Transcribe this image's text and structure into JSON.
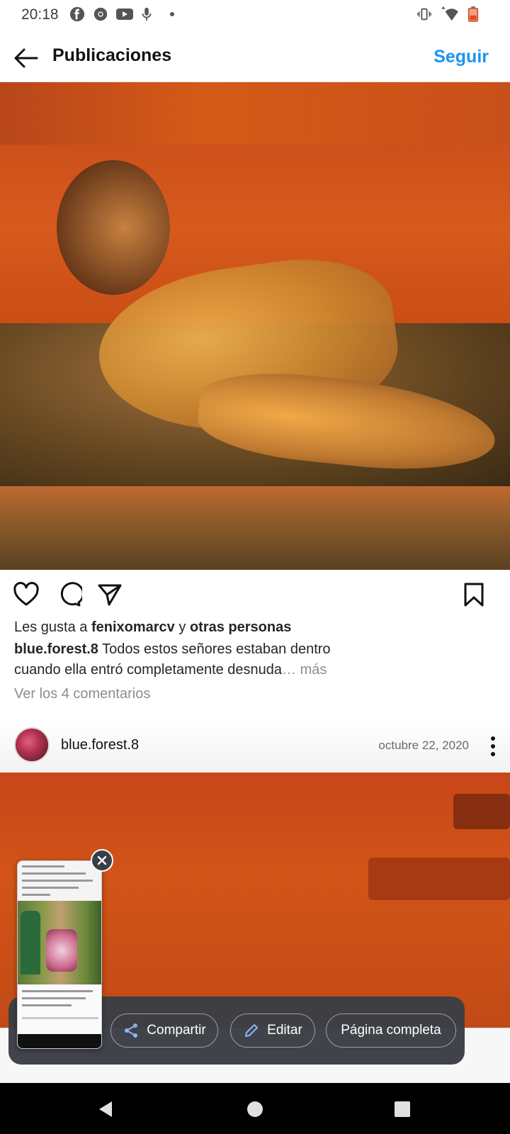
{
  "status_bar": {
    "time": "20:18",
    "icons": [
      "facebook-icon",
      "chrome-icon",
      "youtube-icon",
      "mic-icon",
      "dot-icon",
      "vibrate-icon",
      "wifi-icon",
      "battery-icon"
    ]
  },
  "header": {
    "title": "Publicaciones",
    "follow_label": "Seguir",
    "back_icon": "arrow-left-icon",
    "accent_color": "#1a95f0"
  },
  "post": {
    "likes_prefix": "Les gusta a ",
    "liked_by_user": "fenixomarcv",
    "likes_joiner": " y ",
    "likes_others": "otras personas",
    "caption_user": "blue.forest.8",
    "caption_text": " Todos estos señores estaban dentro cuando ella entró completamente desnuda",
    "caption_ellipsis": "… ",
    "more_label": "más",
    "comments_link": "Ver los 4 comentarios"
  },
  "next_post": {
    "username": "blue.forest.8",
    "date": "octubre 22, 2020"
  },
  "screenshot_toolbar": {
    "share_label": "Compartir",
    "edit_label": "Editar",
    "full_page_label": "Página completa"
  }
}
